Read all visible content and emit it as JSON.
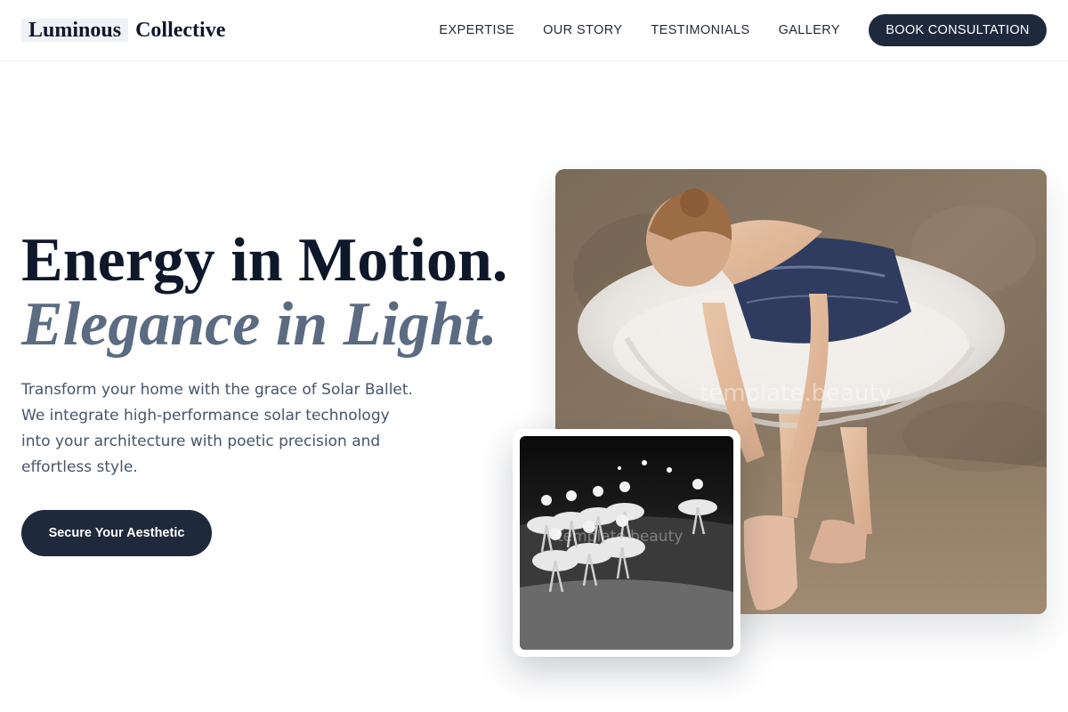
{
  "brand": {
    "word_1": "Luminous",
    "word_2": "Collective"
  },
  "nav": {
    "links": [
      "EXPERTISE",
      "OUR STORY",
      "TESTIMONIALS",
      "GALLERY"
    ],
    "cta_label": "BOOK CONSULTATION"
  },
  "hero": {
    "headline_line_1": "Energy in Motion.",
    "headline_line_2": "Elegance in Light.",
    "description": "Transform your home with the grace of Solar Ballet. We integrate high-performance solar technology into your architecture with poetic precision and effortless style.",
    "cta_label": "Secure Your Aesthetic"
  },
  "images": {
    "watermark_text": "template.beauty"
  },
  "colors": {
    "primary_dark": "#1e293b",
    "headline": "#0f172a",
    "accent_slate": "#5b6b82",
    "body_text": "#475569",
    "logo_highlight": "#eef2f6"
  }
}
